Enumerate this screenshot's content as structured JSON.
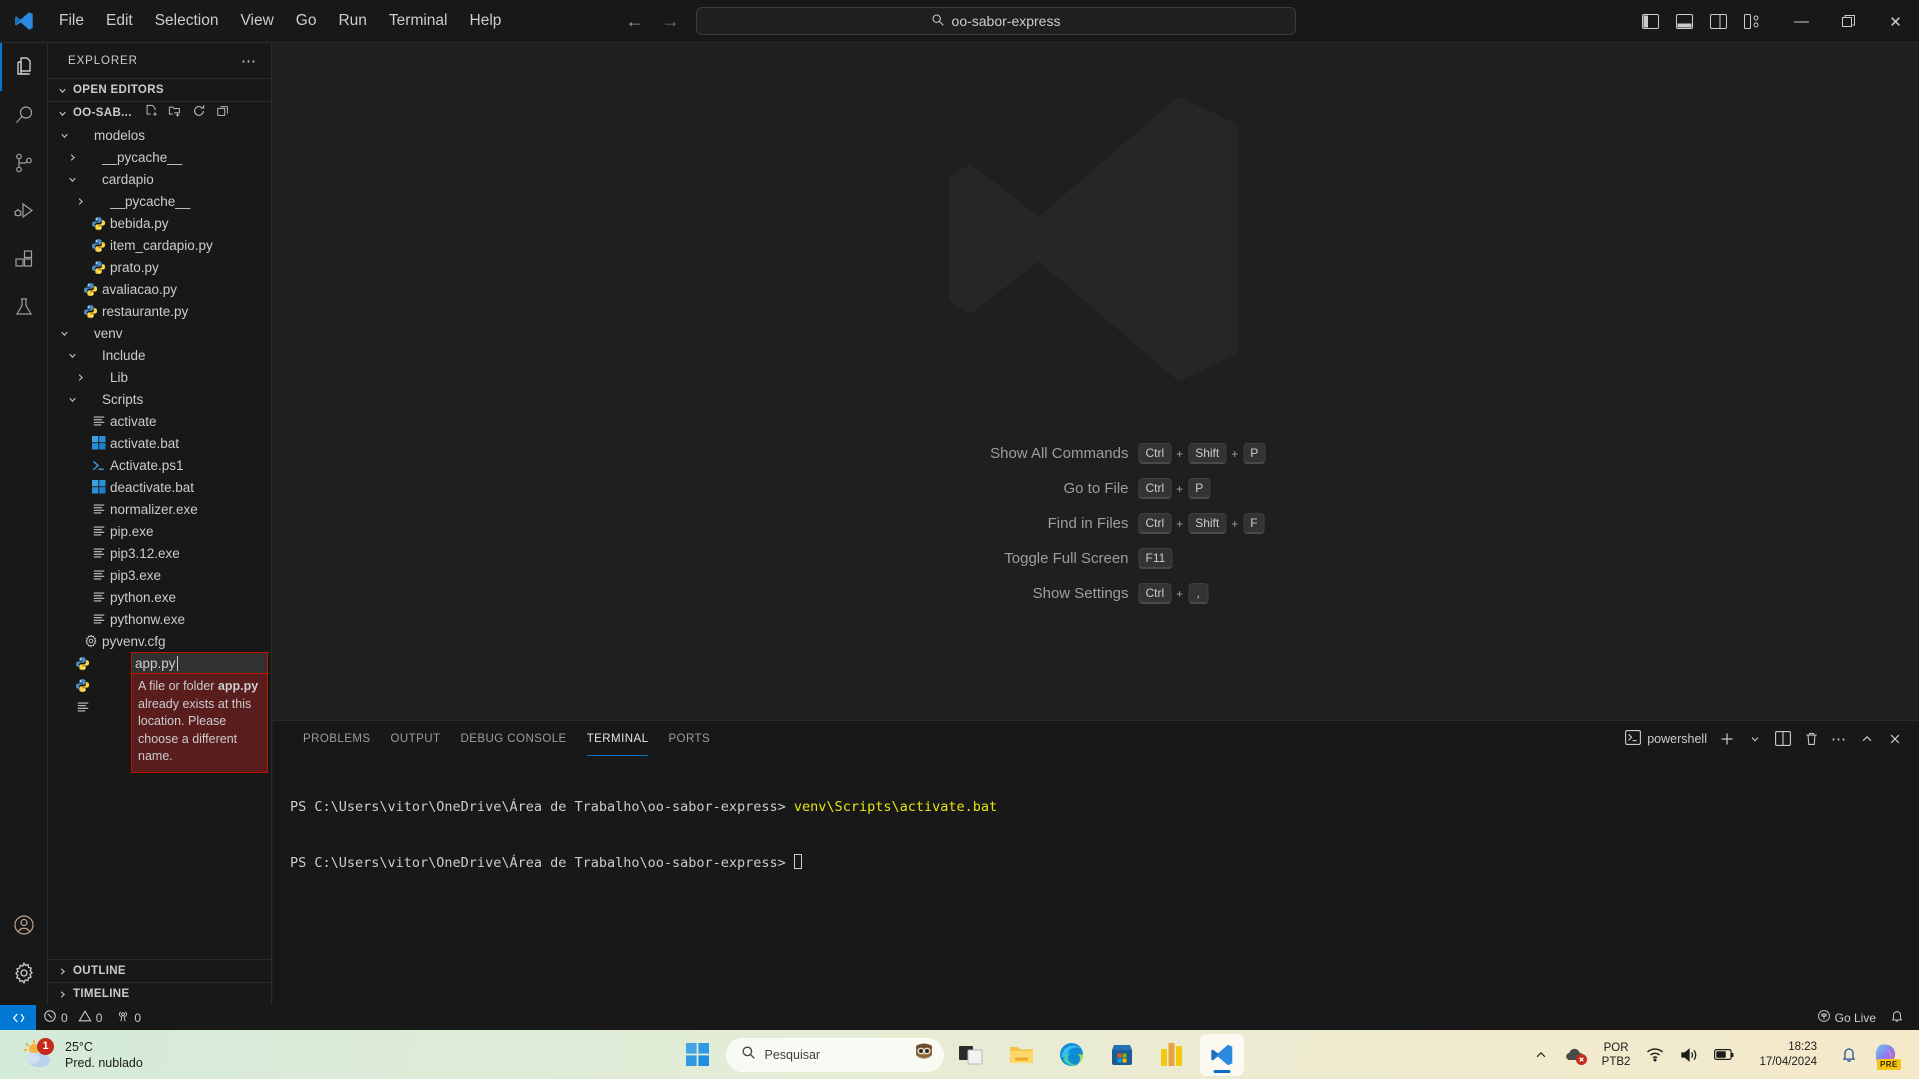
{
  "titlebar": {
    "menus": [
      "File",
      "Edit",
      "Selection",
      "View",
      "Go",
      "Run",
      "Terminal",
      "Help"
    ],
    "back_icon": "arrow-left-icon",
    "forward_icon": "arrow-right-icon",
    "quick_input_value": "oo-sabor-express",
    "search_icon": "search-icon",
    "layout_toggles": [
      "toggle-primary-sidebar",
      "toggle-panel",
      "toggle-secondary-sidebar",
      "customize-layout"
    ],
    "window_controls": {
      "minimize": "—",
      "maximize": "❐",
      "close": "✕"
    }
  },
  "activitybar": {
    "items": [
      {
        "name": "explorer",
        "icon": "files-icon",
        "active": true
      },
      {
        "name": "search",
        "icon": "search-icon",
        "active": false
      },
      {
        "name": "source-control",
        "icon": "source-control-icon",
        "active": false
      },
      {
        "name": "run-debug",
        "icon": "run-and-debug-icon",
        "active": false
      },
      {
        "name": "extensions",
        "icon": "extensions-icon",
        "active": false
      },
      {
        "name": "testing",
        "icon": "beaker-icon",
        "active": false
      }
    ],
    "bottom": [
      {
        "name": "account",
        "icon": "account-icon"
      },
      {
        "name": "settings",
        "icon": "gear-icon"
      }
    ]
  },
  "sidebar": {
    "title": "EXPLORER",
    "more_actions": "⋯",
    "open_editors_label": "OPEN EDITORS",
    "project_name": "OO-SAB...",
    "project_actions": [
      "new-file-icon",
      "new-folder-icon",
      "refresh-explorer-icon",
      "collapse-folders-icon"
    ],
    "tree": [
      {
        "label": "modelos",
        "indent": 1,
        "type": "folder",
        "state": "expanded"
      },
      {
        "label": "__pycache__",
        "indent": 2,
        "type": "folder",
        "state": "collapsed"
      },
      {
        "label": "cardapio",
        "indent": 2,
        "type": "folder",
        "state": "expanded"
      },
      {
        "label": "__pycache__",
        "indent": 3,
        "type": "folder",
        "state": "collapsed"
      },
      {
        "label": "bebida.py",
        "indent": 3,
        "type": "python"
      },
      {
        "label": "item_cardapio.py",
        "indent": 3,
        "type": "python"
      },
      {
        "label": "prato.py",
        "indent": 3,
        "type": "python"
      },
      {
        "label": "avaliacao.py",
        "indent": 2,
        "type": "python"
      },
      {
        "label": "restaurante.py",
        "indent": 2,
        "type": "python"
      },
      {
        "label": "venv",
        "indent": 1,
        "type": "folder",
        "state": "expanded"
      },
      {
        "label": "Include",
        "indent": 2,
        "type": "folder",
        "state": "expanded"
      },
      {
        "label": "Lib",
        "indent": 3,
        "type": "folder",
        "state": "collapsed"
      },
      {
        "label": "Scripts",
        "indent": 2,
        "type": "folder",
        "state": "expanded"
      },
      {
        "label": "activate",
        "indent": 3,
        "type": "text"
      },
      {
        "label": "activate.bat",
        "indent": 3,
        "type": "bat"
      },
      {
        "label": "Activate.ps1",
        "indent": 3,
        "type": "ps1"
      },
      {
        "label": "deactivate.bat",
        "indent": 3,
        "type": "bat"
      },
      {
        "label": "normalizer.exe",
        "indent": 3,
        "type": "text"
      },
      {
        "label": "pip.exe",
        "indent": 3,
        "type": "text"
      },
      {
        "label": "pip3.12.exe",
        "indent": 3,
        "type": "text"
      },
      {
        "label": "pip3.exe",
        "indent": 3,
        "type": "text"
      },
      {
        "label": "python.exe",
        "indent": 3,
        "type": "text"
      },
      {
        "label": "pythonw.exe",
        "indent": 3,
        "type": "text"
      },
      {
        "label": "pyvenv.cfg",
        "indent": 2,
        "type": "gear"
      }
    ],
    "hidden_rows": [
      {
        "indent": 1,
        "type": "python"
      },
      {
        "indent": 1,
        "type": "python"
      },
      {
        "indent": 1,
        "type": "text"
      }
    ],
    "rename": {
      "value": "app.py",
      "error_prefix": "A file or folder ",
      "error_name": "app.py",
      "error_suffix": " already exists at this location. Please choose a different name."
    },
    "outline_label": "OUTLINE",
    "timeline_label": "TIMELINE"
  },
  "editor": {
    "watermark_icon": "vscode-logo-watermark",
    "shortcuts": [
      {
        "label": "Show All Commands",
        "keys": [
          "Ctrl",
          "Shift",
          "P"
        ]
      },
      {
        "label": "Go to File",
        "keys": [
          "Ctrl",
          "P"
        ]
      },
      {
        "label": "Find in Files",
        "keys": [
          "Ctrl",
          "Shift",
          "F"
        ]
      },
      {
        "label": "Toggle Full Screen",
        "keys": [
          "F11"
        ]
      },
      {
        "label": "Show Settings",
        "keys": [
          "Ctrl",
          ","
        ]
      }
    ]
  },
  "panel": {
    "tabs": [
      {
        "label": "PROBLEMS",
        "active": false
      },
      {
        "label": "OUTPUT",
        "active": false
      },
      {
        "label": "DEBUG CONSOLE",
        "active": false
      },
      {
        "label": "TERMINAL",
        "active": true
      },
      {
        "label": "PORTS",
        "active": false
      }
    ],
    "shell_name": "powershell",
    "shell_icon": "terminal-powershell-icon",
    "actions": [
      "new-terminal-icon",
      "chevron-down-icon",
      "split-terminal-icon",
      "kill-terminal-icon",
      "more-actions-icon",
      "maximize-panel-icon",
      "close-panel-icon"
    ],
    "terminal_lines": [
      {
        "prompt": "PS C:\\Users\\vitor\\OneDrive\\Área de Trabalho\\oo-sabor-express> ",
        "command": "venv\\Scripts\\activate.bat"
      },
      {
        "prompt": "PS C:\\Users\\vitor\\OneDrive\\Área de Trabalho\\oo-sabor-express> ",
        "command": ""
      }
    ],
    "accent": "#0078d4",
    "command_color": "#e5e510"
  },
  "statusbar": {
    "remote_icon": "remote-window-icon",
    "errors_icon": "error-icon",
    "errors": "0",
    "warnings_icon": "warning-icon",
    "warnings": "0",
    "ports_icon": "radio-tower-icon",
    "ports": "0",
    "go_live_icon": "broadcast-icon",
    "go_live_label": "Go Live",
    "bell_icon": "bell-icon"
  },
  "taskbar": {
    "weather": {
      "temp": "25°C",
      "desc": "Pred. nublado",
      "badge": "1",
      "icon": "partly-cloudy-icon"
    },
    "start_icon": "windows-start-icon",
    "search": {
      "placeholder": "Pesquisar",
      "icon": "search-icon",
      "mascot": "owl-mascot-icon"
    },
    "apps": [
      {
        "name": "task-view",
        "running": false
      },
      {
        "name": "file-explorer",
        "running": false
      },
      {
        "name": "microsoft-edge",
        "running": true
      },
      {
        "name": "microsoft-store",
        "running": false
      },
      {
        "name": "power-bi",
        "running": true
      },
      {
        "name": "visual-studio-code",
        "running": true,
        "active": true
      }
    ],
    "tray": {
      "overflow_icon": "chevron-up-icon",
      "onedrive_icon": "onedrive-error-icon",
      "language": "POR",
      "keyboard": "PTB2",
      "wifi_icon": "wifi-icon",
      "volume_icon": "volume-icon",
      "battery_icon": "battery-icon",
      "time": "18:23",
      "date": "17/04/2024",
      "notification_icon": "bell-icon",
      "copilot_icon": "copilot-icon",
      "copilot_badge": "PRE"
    }
  }
}
